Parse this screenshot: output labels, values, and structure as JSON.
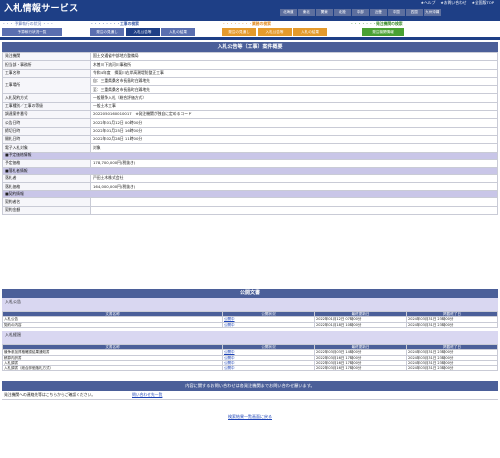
{
  "header": {
    "title": "入札情報サービス",
    "top_links": [
      "★ヘルプ",
      "★お問い合わせ",
      "★全国版TOP"
    ],
    "regions": [
      "北海道",
      "東北",
      "関東",
      "北陸",
      "中部",
      "近畿",
      "中国",
      "四国",
      "九州沖縄"
    ]
  },
  "nav": {
    "groups": [
      {
        "label": "工事の検索",
        "dash": "・・・・・・・・・・・・・・",
        "color": "#3a5aa6",
        "tabs": [
          {
            "label": "発注の見通し",
            "color": "#5a6fb0"
          },
          {
            "label": "入札公告等",
            "color": "#1e3f86",
            "active": true
          },
          {
            "label": "入札の結果",
            "color": "#5a6fb0"
          }
        ]
      },
      {
        "label": "業務の検索",
        "dash": "・・・・・・・・・・・・・・",
        "color": "#e08a1e",
        "tabs": [
          {
            "label": "発注の見通し",
            "color": "#e49a2c"
          },
          {
            "label": "入札公告等",
            "color": "#e49a2c"
          },
          {
            "label": "入札の結果",
            "color": "#e49a2c"
          }
        ]
      },
      {
        "label": "発注機関の検索",
        "dash": "・・・・・・・・・・・・・・",
        "color": "#3b8c2a",
        "tabs": [
          {
            "label": "発注機関情報",
            "color": "#4aa133"
          }
        ]
      }
    ],
    "left_label": "・・・ 予算執行の状況 ・・・",
    "left_tab": "予算執行状況一覧"
  },
  "detail": {
    "heading": "入札公告等（工事）案件概要",
    "rows": [
      {
        "k": "発注機関",
        "v": "国土交通省中部地方整備局"
      },
      {
        "k": "担当部・事務所",
        "v": "木曽川下流河川事務所"
      },
      {
        "k": "工事名称",
        "v": "令和4年度　揖斐川右岸高潮堤防整正工事"
      },
      {
        "k": "工事場所",
        "v": "自：三重県桑名市長島町白鶏地先",
        "v2": "至：三重県桑名市長島町白鶏地先"
      },
      {
        "k": "入札契約方式",
        "v": "一般競争入札（総合評価方式）"
      },
      {
        "k": "工事種別／工事の等級",
        "v": "一般土木工事"
      },
      {
        "k": "調達案件番号",
        "v": "2022050160010017　※発注機関が独自に定めるコード"
      },
      {
        "k": "公告日時",
        "v": "2022年01月12日 00時00分"
      },
      {
        "k": "締切日時",
        "v": "2022年01月25日 16時00分"
      },
      {
        "k": "開札日時",
        "v": "2022年02月28日 11時00分"
      },
      {
        "k": "電子入札対象",
        "v": "対象"
      }
    ],
    "sec_price": "■予定価格情報",
    "price_row": {
      "k": "予定価格",
      "v": "178,700,000円(税抜き)"
    },
    "sec_winner": "■落札者情報",
    "winner_rows": [
      {
        "k": "落札者",
        "v": "戸田土木株式会社"
      },
      {
        "k": "落札価格",
        "v": "164,000,000円(税抜き)"
      }
    ],
    "sec_contract": "■契約情報",
    "contract_rows": [
      {
        "k": "契約者名",
        "v": ""
      },
      {
        "k": "契約金額",
        "v": ""
      }
    ]
  },
  "docs": {
    "heading": "公開文書",
    "columns": [
      "文書名称",
      "公開状況",
      "最終更新日",
      "掲載終了日"
    ],
    "groups": [
      {
        "title": "入札公告",
        "rows": [
          [
            "入札公告",
            "公開中",
            "2022年01月12日 07時00分",
            "2024年03月31日 23時00分"
          ],
          [
            "契約の内容",
            "公開中",
            "2022年01月18日 10時00分",
            "2024年03月31日 23時00分"
          ]
        ]
      },
      {
        "title": "入札経過",
        "rows": [
          [
            "競争参加資格確認結果通知書",
            "公開中",
            "2022年03月03日 14時00分",
            "2024年03月31日 23時00分"
          ],
          [
            "積算内訳書",
            "公開中",
            "2022年03月16日 17時00分",
            "2024年03月31日 23時00分"
          ],
          [
            "入札調書",
            "公開中",
            "2022年03月16日 17時00分",
            "2024年03月31日 23時00分"
          ],
          [
            "入札調書（総合評価落札方式）",
            "公開中",
            "2022年03月16日 17時00分",
            "2024年03月31日 23時00分"
          ]
        ]
      }
    ]
  },
  "footer": {
    "info_bar": "内容に関するお問い合わせは各発注機関までお問い合わせ願います。",
    "contact_text": "発注機関への連絡先等はこちらからご確認ください。",
    "contact_link": "問い合わせ先一覧",
    "back_link": "検索結果一覧画面に戻る"
  }
}
